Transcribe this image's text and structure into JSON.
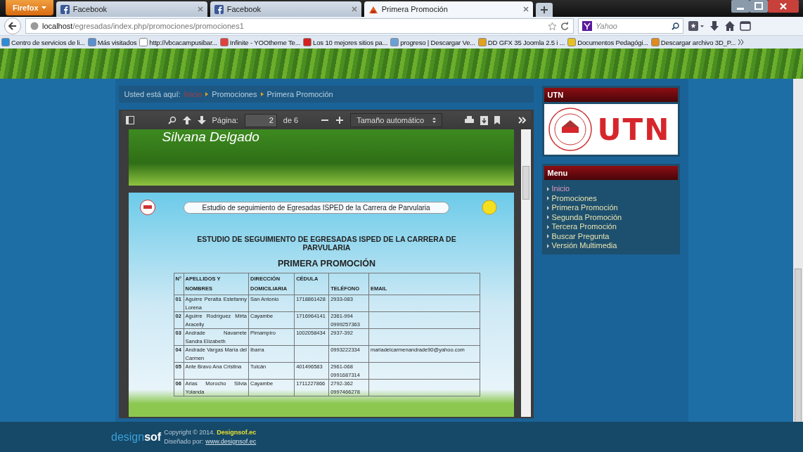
{
  "browser": {
    "menu_button": "Firefox",
    "tabs": [
      {
        "title": "Facebook",
        "selected": false
      },
      {
        "title": "Facebook",
        "selected": false
      },
      {
        "title": "Primera Promoción",
        "selected": true
      }
    ],
    "url": {
      "host": "localhost",
      "path": "/egresadas/index.php/promociones/promociones1"
    },
    "search": {
      "placeholder": "Yahoo"
    },
    "bookmarks": [
      "Centro de servicios de li...",
      "Más visitados",
      "http://vbcacampusibar...",
      "Infinite - YOOtheme Te...",
      "Los 10 mejores sitios pa...",
      "progreso | Descargar Ve...",
      "DD GFX 35 Joomla 2.5 i ...",
      "Documentos Pedagógi...",
      "Descargar archivo 3D_P..."
    ]
  },
  "breadcrumb": {
    "label": "Usted está aquí:",
    "items": [
      "Inicio",
      "Promociones",
      "Primera Promoción"
    ]
  },
  "pdf_viewer": {
    "page_label": "Página:",
    "page_value": "2",
    "page_count": "de 6",
    "zoom": "Tamaño automático",
    "page_1_name": "Silvana Delgado",
    "page_2": {
      "banner": "Estudio de seguimiento de Egresadas ISPED de la Carrera de Parvularia",
      "heading": "ESTUDIO DE SEGUIMIENTO DE EGRESADAS ISPED DE LA CARRERA DE PARVULARIA",
      "subheading": "PRIMERA PROMOCIÓN",
      "table": {
        "columns": [
          "N°",
          "APELLIDOS Y NOMBRES",
          "DIRECCIÓN DOMICILIARIA",
          "CÉDULA",
          "TELÉFONO",
          "EMAIL"
        ],
        "rows": [
          [
            "01",
            "Aguirre Peralta Estefanny Lorena",
            "San Antonio",
            "1718861428",
            "2933-083",
            ""
          ],
          [
            "02",
            "Aguirre Rodríguez Mirta Aracelly",
            "Cayambe",
            "1716964141",
            "2361-994 0999257363",
            ""
          ],
          [
            "03",
            "Andrade Navarrete Sandra Elizabeth",
            "Pimampiro",
            "1002058434",
            "2937-392",
            ""
          ],
          [
            "04",
            "Andrade Vargas María del Carmen",
            "Ibarra",
            "",
            "0993222334",
            "mariadelcarmenandrade90@yahoo.com"
          ],
          [
            "05",
            "Ante Bravo Ana Cristina",
            "Tulcán",
            "401496583",
            "2961-068 0991687314",
            ""
          ],
          [
            "06",
            "Arias Morocho Silvia Yolanda",
            "Cayambe",
            "1711227866",
            "2792-362 0997466278",
            ""
          ]
        ]
      }
    }
  },
  "sidebar": {
    "modules": [
      {
        "kind": "logo",
        "title": "UTN",
        "logo_text": "UTN"
      },
      {
        "kind": "menu",
        "title": "Menu",
        "items": [
          {
            "label": "Inicio",
            "selected": true
          },
          {
            "label": "Promociones",
            "selected": false
          },
          {
            "label": "Primera Promoción",
            "selected": false
          },
          {
            "label": "Segunda Promoción",
            "selected": false
          },
          {
            "label": "Tercera Promoción",
            "selected": false
          },
          {
            "label": "Buscar Pregunta",
            "selected": false
          },
          {
            "label": "Versión Multimedia",
            "selected": false
          }
        ]
      }
    ]
  },
  "footer": {
    "logo_light": "design",
    "logo_bold": "sof",
    "copyright": "Copyright © 2014.",
    "company": "Designsof.ec",
    "designed_by": "Diseñado por:",
    "link": "www.designsof.ec"
  }
}
